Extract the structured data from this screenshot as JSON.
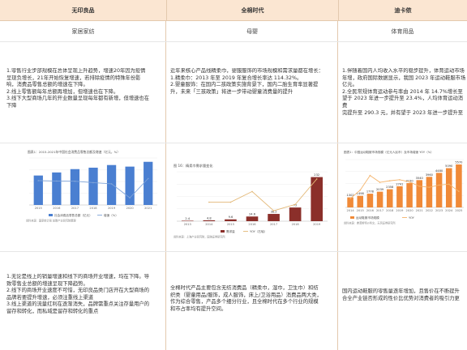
{
  "columns": [
    {
      "brand": "无印良品",
      "category": "家居家纺"
    },
    {
      "brand": "全棉时代",
      "category": "母婴"
    },
    {
      "brand": "迪卡侬",
      "category": "体育用品"
    }
  ],
  "trend_text": [
    "1.零售行业步部规模在总体呈现上升趋势，增速20年因为疫情\n呈现负增长，21年开始恢复增速，若排除疫情的特殊年份影\n响，消费品零售总额的增速在下降。\n2.线上零售额每年总额再增加，但增速也在下降。\n3.线下大型商场几年的开业数量呈现每年都有新增，但增速也在\n下降",
    "近年来核心产品线精柔巾，婴服服饰的市场规模和需求量都在增长：\n1.精柔巾：2013 年至 2019 年复合增长率达 114.32%。\n2.婴童服饰：在国内二孩政策实施背景下，国内二胎生育率显著提\n升，未来「三孩政策」将进一步带动婴童消费量的提升",
    "1.伴随着国内人均收入水平的稳步提升，体育运动市场\n年增，政府国际数据显示，我国 2023 年运动鞋服市场\n亿元。\n2.全民常规体育运动参与率由 2014 年 14.7%增长至\n望于 2023 年进一步提升至 23.4%，人均体育运动消费\n完提升至 290.3 元，并有望于 2023 年进一步提升至"
  ],
  "analysis_text": [
    "1.无论是线上的销量增速和线下的商场开业增速，均在下降。导\n致零售业总额的增速呈现下降趋势。\n2.线下的商场开业速度不可惜，无印良品类门店开在大型商场的\n品牌若要提升增速，必须注重线上渠道\n3.线上渠道的流量红利在逐渐消失，品牌需重点关注存量用户的\n留存和转化，而私域是留存和转化的重点",
    "全棉时代产品主要包含无纺消费品（精柔巾，湿巾，卫生巾）和纺\n织类（婴童用品/服饰，成人服饰，床上/卫浴用品）消费品两大类，\n作为综合零售，产品多个细分行业，且全棉时代在多个行业的规模\n和市占率均有提升空间。",
    "国内运动鞋服的零售量逐年增加，且售价在不断提升\n合全产业链否形成的性价比优势对消费者的吸引力更"
  ],
  "chart_data": [
    {
      "type": "bar",
      "title": "图表1：2015-2021年中国社会消费品零售总额及增速（亿元，%）",
      "categories": [
        "2015",
        "2016",
        "2017",
        "2018",
        "2019",
        "2020",
        "2021"
      ],
      "series": [
        {
          "name": "社会消费品零售总额（亿元）",
          "values": [
            300931,
            332316,
            366262,
            380987,
            408017,
            391981,
            440823
          ]
        },
        {
          "name": "增速（%）",
          "values": [
            10.7,
            10.4,
            10.2,
            9.0,
            8.0,
            -3.9,
            12.5
          ]
        }
      ],
      "source": "资料来源：国家统计局 前瞻产业研究院整理",
      "colors": {
        "bar": "#4a7fd1",
        "line": "#7fa4d9"
      }
    },
    {
      "type": "bar",
      "title": "图 16：精柔巾需求量变化",
      "categories": [
        "2013",
        "2014",
        "2015",
        "2016",
        "2017",
        "2018",
        "2019"
      ],
      "series": [
        {
          "name": "需求量",
          "values": [
            2.4,
            4.8,
            9.6,
            24.6,
            38.2,
            72.0,
            232.0
          ]
        },
        {
          "name": "YOY（右轴）",
          "values": [
            null,
            100,
            100,
            156,
            55,
            88,
            222
          ]
        }
      ],
      "source": "资料来源：上海产业研究院，国海证券研究所",
      "colors": {
        "bar": "#8b2f2a",
        "line": "#e3b877"
      }
    },
    {
      "type": "bar",
      "title": "图表1：中国运动鞋服市场规模（亿元人民币）及市场增速 YOY（%）",
      "categories": [
        "2014",
        "2015",
        "2016",
        "2017",
        "2018",
        "2019",
        "2020",
        "2021",
        "2022",
        "2023",
        "2024",
        "2025"
      ],
      "series": [
        {
          "name": "运动鞋服市场规模",
          "values": [
            1302,
            1498,
            1778,
            2039,
            2358,
            2741,
            3150,
            3540,
            3960,
            4480,
            5090,
            5570
          ]
        },
        {
          "name": "YOY",
          "values": [
            5.2,
            10.1,
            18.7,
            14.7,
            15.6,
            16.2,
            14.9,
            12.4,
            11.8,
            13.1,
            13.6,
            9.4
          ]
        }
      ],
      "source": "资料来源：弗若斯特沙利文，天风证券研究所",
      "colors": {
        "bar": "#f08a38",
        "line": "#f4b36a"
      }
    }
  ]
}
